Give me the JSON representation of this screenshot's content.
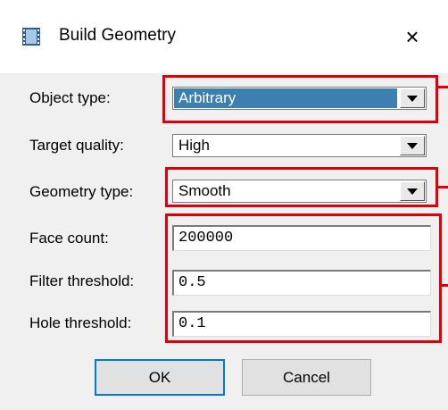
{
  "window": {
    "title": "Build Geometry",
    "close_glyph": "×",
    "icon": "film-icon"
  },
  "form": {
    "object_type": {
      "label": "Object type:",
      "value": "Arbitrary",
      "selected": true
    },
    "target_quality": {
      "label": "Target quality:",
      "value": "High"
    },
    "geometry_type": {
      "label": "Geometry type:",
      "value": "Smooth"
    },
    "face_count": {
      "label": "Face count:",
      "value": "200000"
    },
    "filter_threshold": {
      "label": "Filter threshold:",
      "value": "0.5"
    },
    "hole_threshold": {
      "label": "Hole threshold:",
      "value": "0.1"
    }
  },
  "buttons": {
    "ok": "OK",
    "cancel": "Cancel"
  },
  "colors": {
    "highlight": "#e0000c",
    "selection": "#3c7fb1"
  }
}
